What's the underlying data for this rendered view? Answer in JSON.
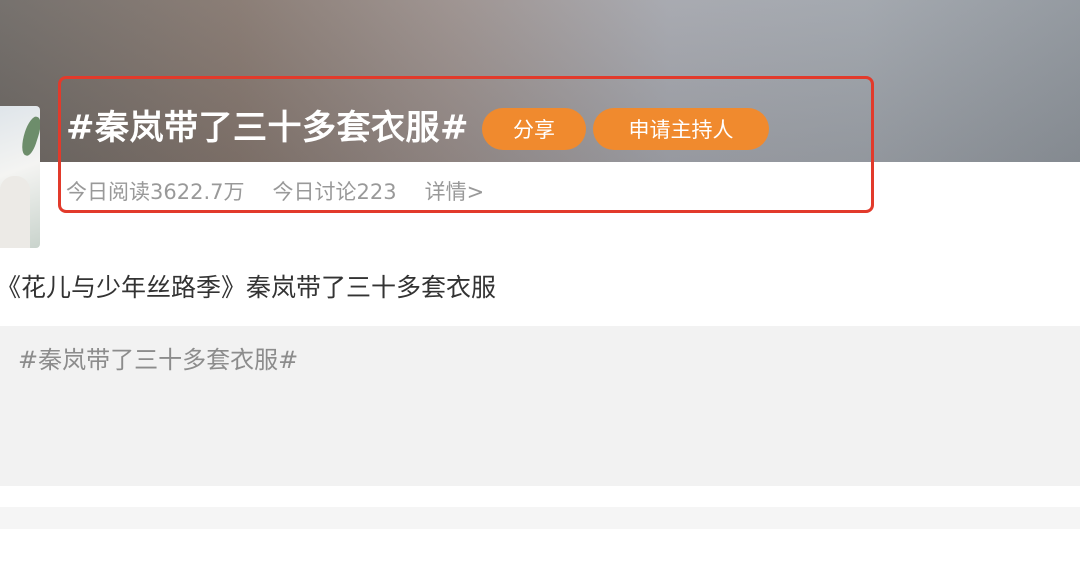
{
  "topic": {
    "title": "#秦岚带了三十多套衣服#",
    "share_label": "分享",
    "host_label": "申请主持人",
    "stats": {
      "reads": "今日阅读3622.7万",
      "discussions": "今日讨论223",
      "details": "详情>"
    }
  },
  "description": "《花儿与少年丝路季》秦岚带了三十多套衣服",
  "composer": {
    "text": "#秦岚带了三十多套衣服#"
  },
  "colors": {
    "accent": "#f08a2e",
    "highlight_border": "#e23a2b"
  }
}
